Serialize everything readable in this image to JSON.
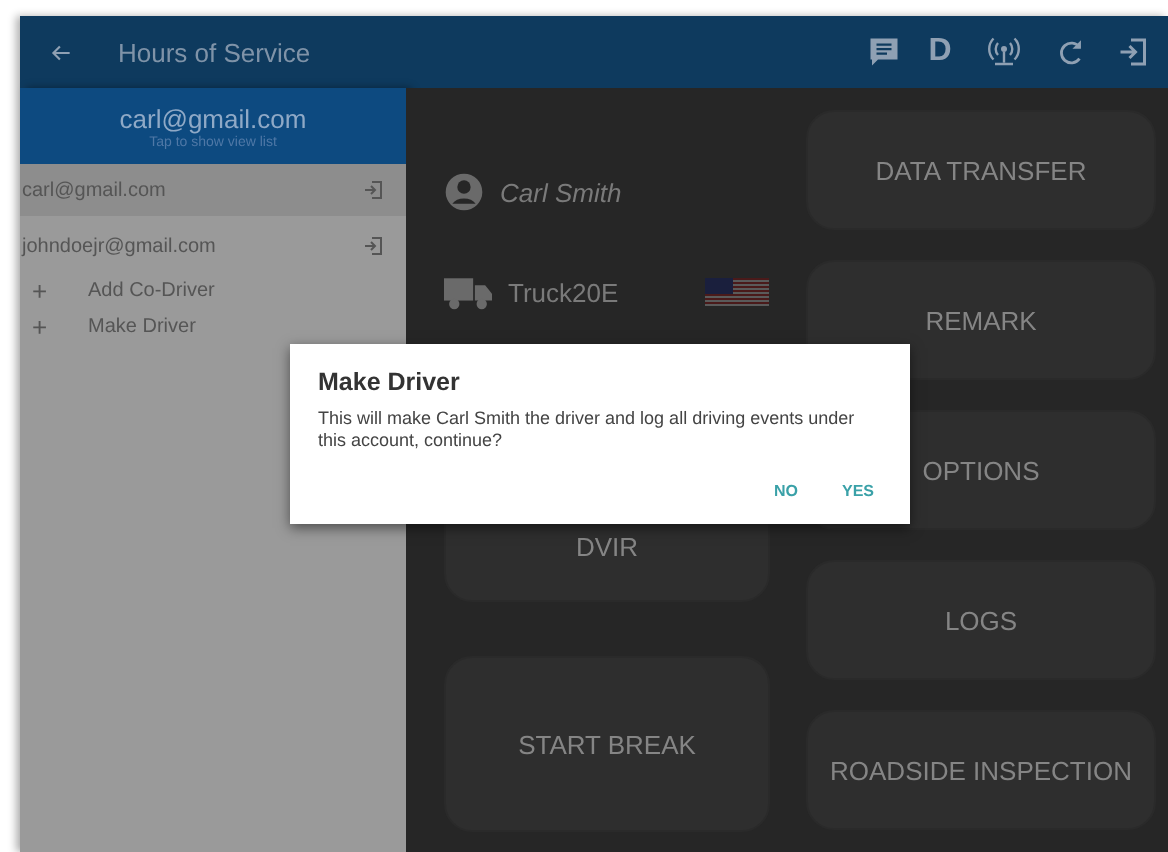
{
  "app_bar": {
    "title": "Hours of Service",
    "driver_badge": "D"
  },
  "drawer": {
    "header": {
      "email": "carl@gmail.com",
      "hint": "Tap to show view list"
    },
    "accounts": [
      {
        "email": "carl@gmail.com",
        "selected": true
      },
      {
        "email": "johndoejr@gmail.com",
        "selected": false
      }
    ],
    "actions": [
      {
        "symbol": "+",
        "label": "Add Co-Driver"
      },
      {
        "symbol": "+",
        "label": "Make Driver"
      }
    ]
  },
  "dashboard": {
    "driver": "Carl Smith",
    "vehicle": "Truck20E",
    "left_buttons": [
      "DVIR",
      "START BREAK"
    ],
    "right_buttons": [
      "DATA TRANSFER",
      "REMARK",
      "OPTIONS",
      "LOGS",
      "ROADSIDE INSPECTION"
    ]
  },
  "dialog": {
    "title": "Make Driver",
    "message": "This will make Carl Smith the driver and log all driving events under this account, continue?",
    "buttons": [
      "NO",
      "YES"
    ]
  }
}
